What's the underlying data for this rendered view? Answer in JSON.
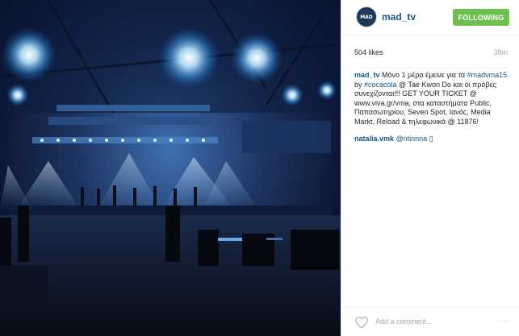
{
  "post": {
    "photo_description": "concert hall stage with blue lights",
    "username": "mad_tv",
    "avatar_text": "MAD",
    "follow_label": "FOLLOWING",
    "likes": "504 likes",
    "time_ago": "38m"
  },
  "caption": {
    "user": "mad_tv",
    "text_1": " Μόνο 1 μέρα έμεινε για τα ",
    "hashtag_1": "#madvma15",
    "text_2": " by ",
    "hashtag_2": "#cocacola",
    "text_3": " @ Tae Kwon Do και οι πρόβες συνεχίζονται!!! GET YOUR TICKET @ www.viva.gr/vma, στα καταστήματα Public, Παπασωτηρίου, Seven Spot, Ιανός, Media Markt, Reload & τηλεφωνικά @ 11876!"
  },
  "comment": {
    "user": "natalia.vmk",
    "text": " @ntinnna ",
    "emoji": "▯"
  },
  "footer": {
    "add_comment_placeholder": "Add a comment...",
    "more_label": "···"
  },
  "colors": {
    "follow_button": "#70c050",
    "link": "#125688",
    "muted": "#a5a7aa"
  },
  "icons": {
    "like": "heart-outline-icon",
    "more": "ellipsis-icon"
  }
}
